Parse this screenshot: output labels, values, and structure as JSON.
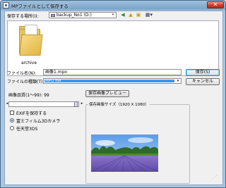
{
  "window": {
    "title": "MPファイルとして保存する",
    "close_glyph": "✕"
  },
  "location": {
    "label": "保存する場所(I):",
    "value": "backup_No1 (D:)",
    "arrow": "▾"
  },
  "toolbar": {
    "back_glyph": "◀",
    "up_glyph": "▲",
    "new_folder_glyph": "▣",
    "view_glyph": "▦▾"
  },
  "filelist": {
    "items": [
      {
        "label": "archive"
      }
    ]
  },
  "filename": {
    "label": "ファイル名(N):",
    "value": "画像1.mpo"
  },
  "filetype": {
    "label": "ファイルの種類(T):",
    "value": "MPO file",
    "arrow": "▾"
  },
  "buttons": {
    "save": "保存(S)",
    "cancel": "キャンセル",
    "preview": "保存画像プレビュー"
  },
  "quality": {
    "label": "画像品質(1～99): 99",
    "left_arrow": "◂",
    "right_arrow": "▸",
    "value": 0.99
  },
  "exif": {
    "label": "EXIFを保持する",
    "checked": false
  },
  "camera": {
    "options": [
      {
        "label": "富士フィルム3Dカメラ",
        "selected": true
      },
      {
        "label": "任天堂3DS",
        "selected": false
      }
    ]
  },
  "preview": {
    "caption": "保存画像サイズ（1920 X 1080）"
  },
  "colors": {
    "accent": "#3399ff",
    "titlebar": "#7aa3c9",
    "close": "#c7432c"
  }
}
